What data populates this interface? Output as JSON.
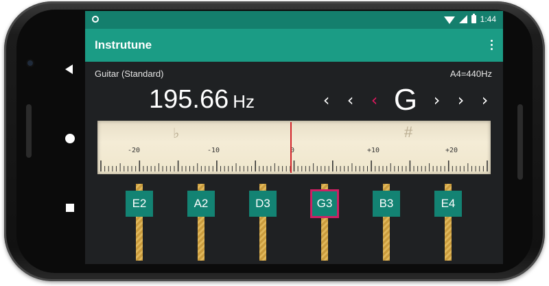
{
  "statusbar": {
    "time": "1:44"
  },
  "app": {
    "title": "Instrutune"
  },
  "tuner": {
    "instrument": "Guitar (Standard)",
    "reference": "A4=440Hz",
    "frequency": "195.66",
    "frequency_unit": "Hz",
    "note": "G",
    "flat_arrows": [
      "‹",
      "‹",
      "‹"
    ],
    "sharp_arrows": [
      "›",
      "›",
      "›"
    ]
  },
  "meter": {
    "labels": [
      "-20",
      "-10",
      "0",
      "+10",
      "+20"
    ],
    "flat_symbol": "♭",
    "sharp_symbol": "#"
  },
  "strings": [
    {
      "label": "E2",
      "selected": false
    },
    {
      "label": "A2",
      "selected": false
    },
    {
      "label": "D3",
      "selected": false
    },
    {
      "label": "G3",
      "selected": true
    },
    {
      "label": "B3",
      "selected": false
    },
    {
      "label": "E4",
      "selected": false
    }
  ],
  "colors": {
    "statusbar": "#147f6d",
    "appbar": "#1b9c85",
    "accent": "#e0185f",
    "string_button": "#138373"
  }
}
